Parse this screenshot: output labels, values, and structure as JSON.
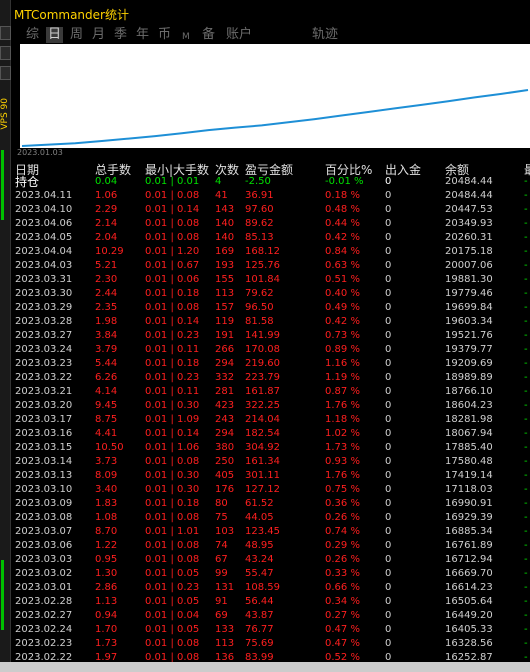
{
  "title": "MTCommander统计",
  "left_toolbar": {
    "vertical_label": "VPS 90"
  },
  "tabs": [
    {
      "label": "综"
    },
    {
      "label": "日"
    },
    {
      "label": "周"
    },
    {
      "label": "月"
    },
    {
      "label": "季"
    },
    {
      "label": "年"
    },
    {
      "label": "币"
    },
    {
      "label": "M"
    },
    {
      "label": "备"
    },
    {
      "label": "账户"
    },
    {
      "label": "轨迹"
    }
  ],
  "active_tab": "日",
  "colors": {
    "accent": "#ffd200",
    "loss": "#ff1f1f",
    "profit": "#00e000",
    "line": "#1e8fd6"
  },
  "chart": {
    "start_date": "2023.01.03",
    "series": [
      10,
      14,
      18,
      24,
      31,
      38,
      46,
      55,
      62,
      68,
      77,
      86,
      96,
      106,
      116,
      126,
      136,
      147,
      157,
      168
    ]
  },
  "table": {
    "headers": {
      "date": "日期",
      "count": "总手数",
      "lots": "最小|大手数",
      "times": "次数",
      "pl": "盈亏金额",
      "pct": "百分比%",
      "io": "出入金",
      "bal": "余额",
      "last": "最"
    },
    "holding": {
      "date": "持仓",
      "count": "0.04",
      "lots": "0.01 | 0.01",
      "times": "4",
      "pl": "-2.50",
      "pct": "-0.01 %",
      "io": "0",
      "bal": "20484.44",
      "last": "-"
    },
    "rows": [
      [
        "2023.04.11",
        "1.06",
        "0.01 | 0.08",
        "41",
        "36.91",
        "0.18 %",
        "0",
        "20484.44"
      ],
      [
        "2023.04.10",
        "2.29",
        "0.01 | 0.14",
        "143",
        "97.60",
        "0.48 %",
        "0",
        "20447.53"
      ],
      [
        "2023.04.06",
        "2.14",
        "0.01 | 0.08",
        "140",
        "89.62",
        "0.44 %",
        "0",
        "20349.93"
      ],
      [
        "2023.04.05",
        "2.04",
        "0.01 | 0.08",
        "140",
        "85.13",
        "0.42 %",
        "0",
        "20260.31"
      ],
      [
        "2023.04.04",
        "10.29",
        "0.01 | 1.20",
        "169",
        "168.12",
        "0.84 %",
        "0",
        "20175.18"
      ],
      [
        "2023.04.03",
        "5.21",
        "0.01 | 0.67",
        "193",
        "125.76",
        "0.63 %",
        "0",
        "20007.06"
      ],
      [
        "2023.03.31",
        "2.30",
        "0.01 | 0.06",
        "155",
        "101.84",
        "0.51 %",
        "0",
        "19881.30"
      ],
      [
        "2023.03.30",
        "2.44",
        "0.01 | 0.18",
        "113",
        "79.62",
        "0.40 %",
        "0",
        "19779.46"
      ],
      [
        "2023.03.29",
        "2.35",
        "0.01 | 0.08",
        "157",
        "96.50",
        "0.49 %",
        "0",
        "19699.84"
      ],
      [
        "2023.03.28",
        "1.98",
        "0.01 | 0.14",
        "119",
        "81.58",
        "0.42 %",
        "0",
        "19603.34"
      ],
      [
        "2023.03.27",
        "3.84",
        "0.01 | 0.23",
        "191",
        "141.99",
        "0.73 %",
        "0",
        "19521.76"
      ],
      [
        "2023.03.24",
        "3.79",
        "0.01 | 0.11",
        "266",
        "170.08",
        "0.89 %",
        "0",
        "19379.77"
      ],
      [
        "2023.03.23",
        "5.44",
        "0.01 | 0.18",
        "294",
        "219.60",
        "1.16 %",
        "0",
        "19209.69"
      ],
      [
        "2023.03.22",
        "6.26",
        "0.01 | 0.23",
        "332",
        "223.79",
        "1.19 %",
        "0",
        "18989.89"
      ],
      [
        "2023.03.21",
        "4.14",
        "0.01 | 0.11",
        "281",
        "161.87",
        "0.87 %",
        "0",
        "18766.10"
      ],
      [
        "2023.03.20",
        "9.45",
        "0.01 | 0.30",
        "423",
        "322.25",
        "1.76 %",
        "0",
        "18604.23"
      ],
      [
        "2023.03.17",
        "8.75",
        "0.01 | 1.09",
        "243",
        "214.04",
        "1.18 %",
        "0",
        "18281.98"
      ],
      [
        "2023.03.16",
        "4.41",
        "0.01 | 0.14",
        "294",
        "182.54",
        "1.02 %",
        "0",
        "18067.94"
      ],
      [
        "2023.03.15",
        "10.50",
        "0.01 | 1.06",
        "380",
        "304.92",
        "1.73 %",
        "0",
        "17885.40"
      ],
      [
        "2023.03.14",
        "3.73",
        "0.01 | 0.08",
        "250",
        "161.34",
        "0.93 %",
        "0",
        "17580.48"
      ],
      [
        "2023.03.13",
        "8.09",
        "0.01 | 0.30",
        "405",
        "301.11",
        "1.76 %",
        "0",
        "17419.14"
      ],
      [
        "2023.03.10",
        "3.40",
        "0.01 | 0.30",
        "176",
        "127.12",
        "0.75 %",
        "0",
        "17118.03"
      ],
      [
        "2023.03.09",
        "1.83",
        "0.01 | 0.18",
        "80",
        "61.52",
        "0.36 %",
        "0",
        "16990.91"
      ],
      [
        "2023.03.08",
        "1.08",
        "0.01 | 0.08",
        "75",
        "44.05",
        "0.26 %",
        "0",
        "16929.39"
      ],
      [
        "2023.03.07",
        "8.70",
        "0.01 | 1.01",
        "103",
        "123.45",
        "0.74 %",
        "0",
        "16885.34"
      ],
      [
        "2023.03.06",
        "1.22",
        "0.01 | 0.08",
        "74",
        "48.95",
        "0.29 %",
        "0",
        "16761.89"
      ],
      [
        "2023.03.03",
        "0.95",
        "0.01 | 0.08",
        "67",
        "43.24",
        "0.26 %",
        "0",
        "16712.94"
      ],
      [
        "2023.03.02",
        "1.30",
        "0.01 | 0.05",
        "99",
        "55.47",
        "0.33 %",
        "0",
        "16669.70"
      ],
      [
        "2023.03.01",
        "2.86",
        "0.01 | 0.23",
        "131",
        "108.59",
        "0.66 %",
        "0",
        "16614.23"
      ],
      [
        "2023.02.28",
        "1.13",
        "0.01 | 0.05",
        "91",
        "56.44",
        "0.34 %",
        "0",
        "16505.64"
      ],
      [
        "2023.02.27",
        "0.94",
        "0.01 | 0.04",
        "69",
        "43.87",
        "0.27 %",
        "0",
        "16449.20"
      ],
      [
        "2023.02.24",
        "1.70",
        "0.01 | 0.05",
        "133",
        "76.77",
        "0.47 %",
        "0",
        "16405.33"
      ],
      [
        "2023.02.23",
        "1.73",
        "0.01 | 0.08",
        "113",
        "75.69",
        "0.47 %",
        "0",
        "16328.56"
      ],
      [
        "2023.02.22",
        "1.97",
        "0.01 | 0.08",
        "136",
        "83.99",
        "0.52 %",
        "0",
        "16252.87"
      ]
    ]
  }
}
